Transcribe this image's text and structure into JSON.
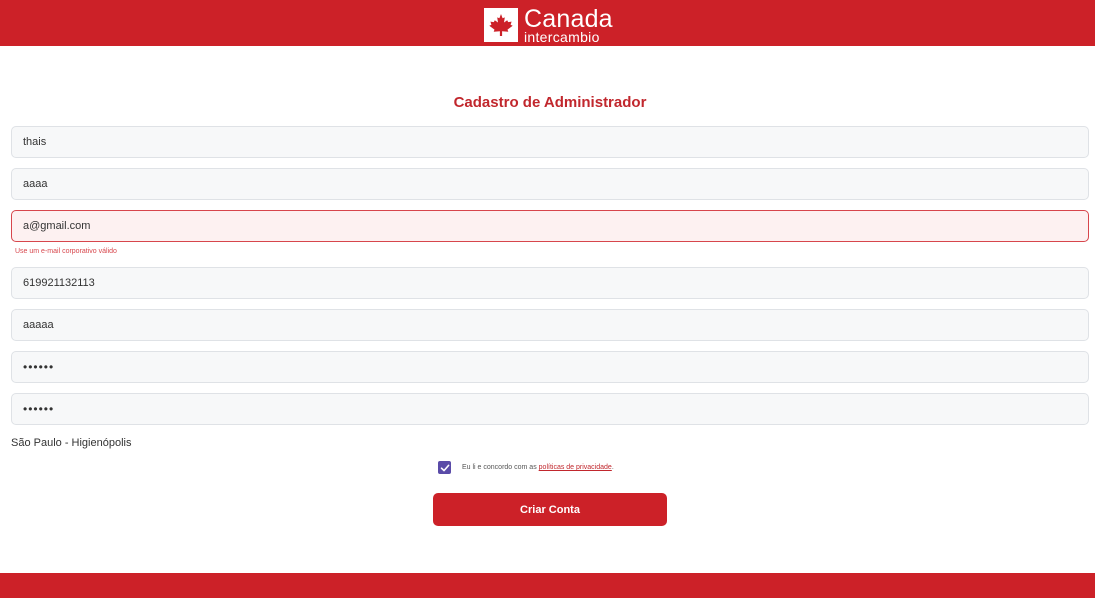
{
  "header": {
    "logo_title": "Canada",
    "logo_subtitle": "intercambio",
    "brand_color": "#cc2128"
  },
  "form": {
    "title": "Cadastro de Administrador",
    "fields": [
      {
        "value": "thais"
      },
      {
        "value": "aaaa"
      },
      {
        "value": "a@gmail.com",
        "error": "Use um e-mail corporativo válido"
      },
      {
        "value": "619921132113"
      },
      {
        "value": "aaaaa"
      },
      {
        "value": "••••••"
      },
      {
        "value": "••••••"
      }
    ],
    "location": "São Paulo - Higienópolis",
    "consent": {
      "checked": true,
      "text": "Eu li e concordo com as",
      "link": "políticas de privacidade",
      "suffix": "."
    },
    "submit_label": "Criar Conta"
  },
  "icons": {
    "logo": "maple-leaf-icon",
    "checkbox": "checkmark-icon"
  }
}
